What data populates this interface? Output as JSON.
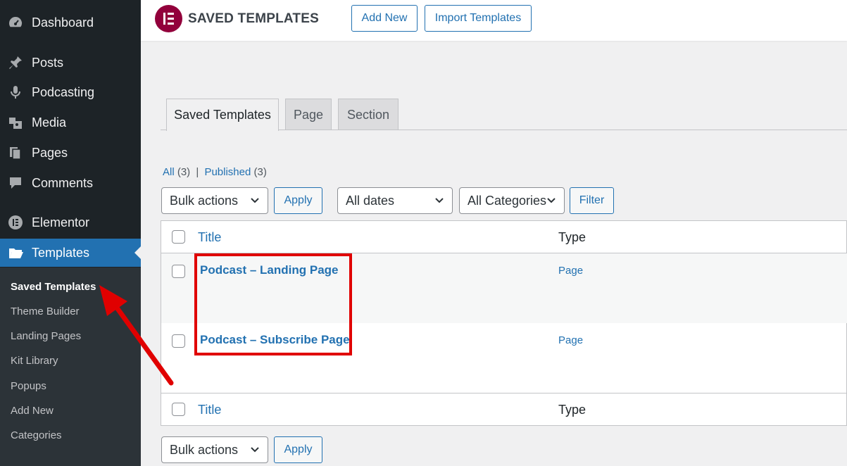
{
  "sidebar": {
    "items": [
      {
        "label": "Dashboard",
        "icon": "dashboard-icon"
      },
      {
        "label": "Posts",
        "icon": "pushpin-icon"
      },
      {
        "label": "Podcasting",
        "icon": "microphone-icon"
      },
      {
        "label": "Media",
        "icon": "media-icon"
      },
      {
        "label": "Pages",
        "icon": "pages-icon"
      },
      {
        "label": "Comments",
        "icon": "comment-icon"
      },
      {
        "label": "Elementor",
        "icon": "elementor-icon"
      },
      {
        "label": "Templates",
        "icon": "folder-icon"
      }
    ],
    "submenu": [
      "Saved Templates",
      "Theme Builder",
      "Landing Pages",
      "Kit Library",
      "Popups",
      "Add New",
      "Categories"
    ]
  },
  "header": {
    "title": "SAVED TEMPLATES",
    "add_new": "Add New",
    "import": "Import Templates"
  },
  "tabs": [
    "Saved Templates",
    "Page",
    "Section"
  ],
  "filters": {
    "all": "All",
    "all_count": "(3)",
    "separator": "|",
    "published": "Published",
    "published_count": "(3)"
  },
  "controls": {
    "bulk_actions": "Bulk actions",
    "apply": "Apply",
    "dates": "All dates",
    "categories": "All Categories",
    "filter": "Filter"
  },
  "table": {
    "col_title": "Title",
    "col_type": "Type",
    "rows": [
      {
        "title": "Podcast – Landing Page",
        "type": "Page"
      },
      {
        "title": "Podcast – Subscribe Page",
        "type": "Page"
      }
    ]
  },
  "colors": {
    "sidebar_bg": "#1d2327",
    "submenu_bg": "#2c3338",
    "accent": "#2271b1",
    "elementor": "#92003b",
    "annotation": "#e00000"
  }
}
